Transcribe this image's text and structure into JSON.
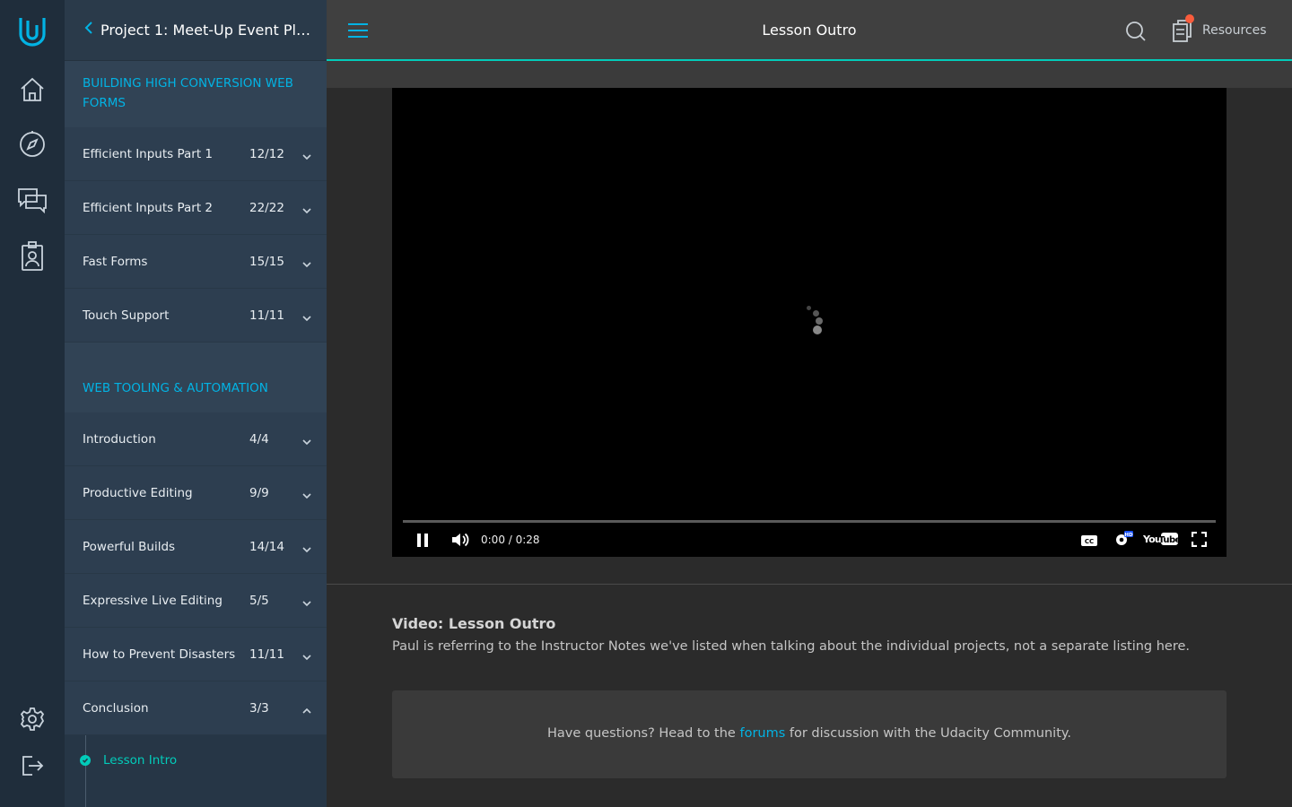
{
  "rail": {
    "icons": [
      "udacity-logo-icon",
      "home-icon",
      "compass-icon",
      "chat-icon",
      "id-badge-icon",
      "gear-icon",
      "logout-icon"
    ]
  },
  "sidebar": {
    "back_label": "Project 1: Meet-Up Event Plan...",
    "sections": [
      {
        "title": "BUILDING HIGH CONVERSION WEB FORMS",
        "lessons": [
          {
            "name": "Efficient Inputs Part 1",
            "count": "12/12"
          },
          {
            "name": "Efficient Inputs Part 2",
            "count": "22/22"
          },
          {
            "name": "Fast Forms",
            "count": "15/15"
          },
          {
            "name": "Touch Support",
            "count": "11/11"
          }
        ]
      },
      {
        "title": "WEB TOOLING & AUTOMATION",
        "lessons": [
          {
            "name": "Introduction",
            "count": "4/4"
          },
          {
            "name": "Productive Editing",
            "count": "9/9"
          },
          {
            "name": "Powerful Builds",
            "count": "14/14"
          },
          {
            "name": "Expressive Live Editing",
            "count": "5/5"
          },
          {
            "name": "How to Prevent Disasters",
            "count": "11/11"
          },
          {
            "name": "Conclusion",
            "count": "3/3"
          }
        ]
      }
    ],
    "concept": "Lesson Intro"
  },
  "topbar": {
    "title": "Lesson Outro",
    "resources_label": "Resources"
  },
  "video": {
    "time": "0:00 / 0:28",
    "progress": 0
  },
  "description": {
    "title": "Video: Lesson Outro",
    "text": "Paul is referring to the Instructor Notes we've listed when talking about the individual projects, not a separate listing here."
  },
  "forum": {
    "prefix": "Have questions? Head to the ",
    "link": "forums",
    "suffix": " for discussion with the Udacity Community."
  },
  "colors": {
    "accent": "#02b3e4",
    "teal": "#02ccba",
    "badge": "#f95c3c"
  }
}
